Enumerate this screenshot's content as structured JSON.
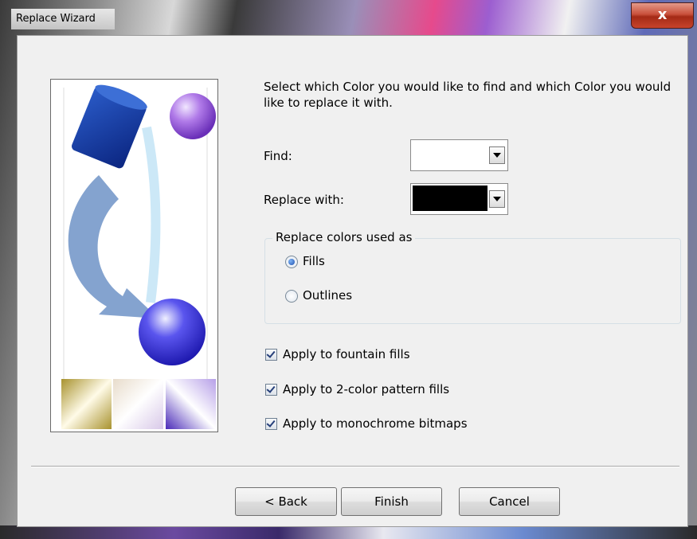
{
  "window": {
    "title": "Replace Wizard",
    "close_label": "x"
  },
  "intro_text": "Select which Color you would like to find and which Color you would like to replace it with.",
  "find": {
    "label": "Find:",
    "color": "#ffffff"
  },
  "replace_with": {
    "label": "Replace with:",
    "color": "#000000"
  },
  "replace_group": {
    "legend": "Replace colors used as",
    "options": [
      {
        "label": "Fills",
        "selected": true
      },
      {
        "label": "Outlines",
        "selected": false
      }
    ]
  },
  "checkboxes": [
    {
      "label": "Apply to fountain fills",
      "checked": true
    },
    {
      "label": "Apply to 2-color pattern fills",
      "checked": true
    },
    {
      "label": "Apply to monochrome bitmaps",
      "checked": true
    }
  ],
  "buttons": {
    "back": "< Back",
    "finish": "Finish",
    "cancel": "Cancel"
  },
  "colors": {
    "dialog_bg": "#f0f0f0",
    "close_red": "#c7432b",
    "accent_blue": "#1e4fae"
  },
  "icons": [
    "close-icon",
    "dropdown-arrow-icon",
    "paint-bucket-illustration"
  ]
}
